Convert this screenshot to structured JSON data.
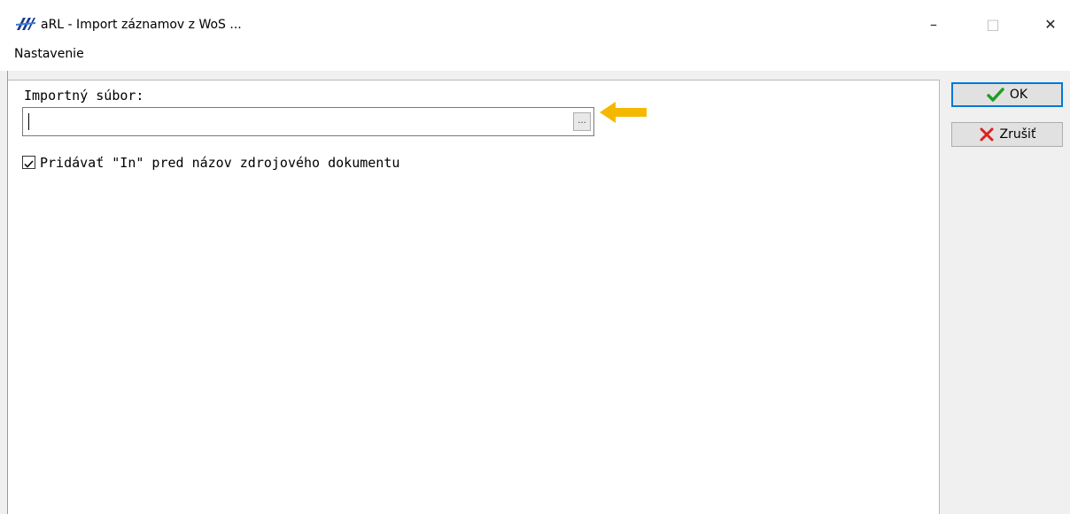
{
  "window": {
    "title": "aRL - Import záznamov z WoS ...",
    "icon": "arl-app-icon",
    "controls": {
      "minimize": "–",
      "maximize": "□",
      "close": "✕"
    }
  },
  "menu": {
    "items": [
      {
        "label": "Nastavenie"
      }
    ]
  },
  "form": {
    "file_label": "Importný súbor:",
    "file_value": "",
    "browse_label": "...",
    "checkbox_label": "Pridávať \"In\" pred názov zdrojového dokumentu",
    "checkbox_checked": true
  },
  "buttons": {
    "ok_label": "OK",
    "ok_icon": "checkmark-icon",
    "cancel_label": "Zrušiť",
    "cancel_icon": "red-x-icon"
  },
  "colors": {
    "accent": "#0078d7",
    "arrow": "#f5b800",
    "ok_icon": "#1f9e1f",
    "cancel_icon": "#e02020"
  }
}
